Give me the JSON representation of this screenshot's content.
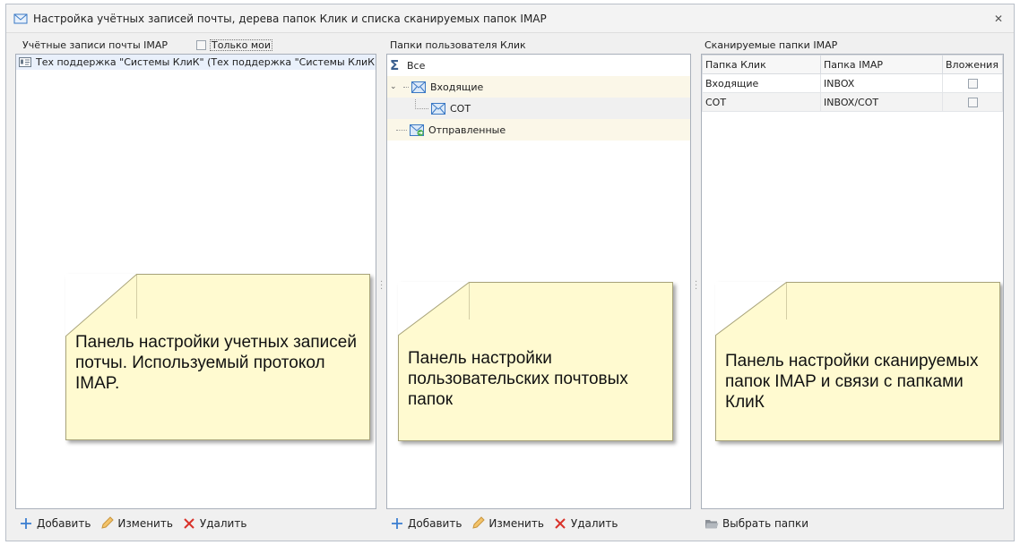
{
  "window": {
    "title": "Настройка учётных записей почты, дерева папок Клик и списка сканируемых папок IMAP",
    "close_glyph": "✕"
  },
  "accounts_panel": {
    "header": "Учётные записи почты IMAP",
    "only_mine_label": "Только мои",
    "only_mine_checked": false,
    "accounts": [
      "Тех поддержка \"Системы КлиК\" (Тех поддержка \"Системы КлиК"
    ],
    "buttons": {
      "add": "Добавить",
      "edit": "Изменить",
      "delete": "Удалить"
    },
    "note": "Панель настройки учетных записей потчы. Используемый протокол IMAP."
  },
  "folders_panel": {
    "header": "Папки пользователя Клик",
    "tree": [
      {
        "label": "Все",
        "icon": "sigma-icon"
      },
      {
        "label": "Входящие",
        "icon": "mail-icon"
      },
      {
        "label": "СОТ",
        "icon": "mail-icon"
      },
      {
        "label": "Отправленные",
        "icon": "mail-sent-icon"
      }
    ],
    "buttons": {
      "add": "Добавить",
      "edit": "Изменить",
      "delete": "Удалить"
    },
    "note": "Панель настройки пользовательских почтовых папок"
  },
  "imap_panel": {
    "header": "Сканируемые папки IMAP",
    "columns": [
      "Папка Клик",
      "Папка IMAP",
      "Вложения"
    ],
    "rows": [
      {
        "klik": "Входящие",
        "imap": "INBOX",
        "attachments": false
      },
      {
        "klik": "СОТ",
        "imap": "INBOX/СОТ",
        "attachments": false
      }
    ],
    "buttons": {
      "select": "Выбрать папки"
    },
    "note": "Панель настройки сканируемых папок IMAP и связи с папками КлиК"
  },
  "colors": {
    "accent": "#3a78c4",
    "note_bg": "#fffad0",
    "delete_red": "#d9322a",
    "add_blue": "#3c7fd1"
  }
}
